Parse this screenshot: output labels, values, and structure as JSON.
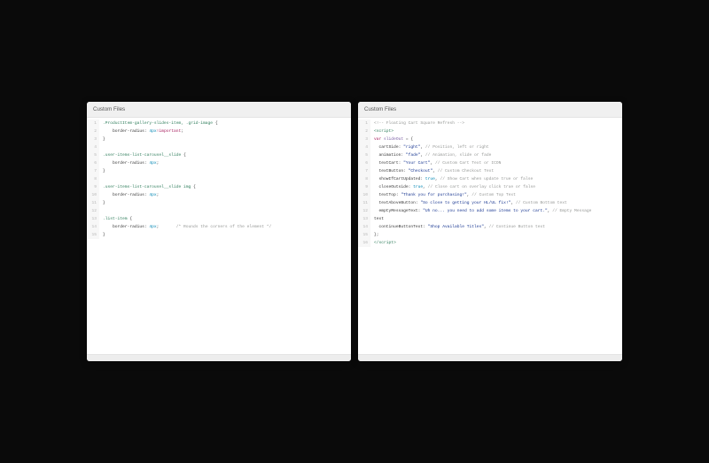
{
  "left": {
    "title": "Custom Files",
    "lines": [
      {
        "n": 1,
        "tokens": [
          {
            "c": "t-sel",
            "t": ".ProductItem-gallery-slides-item, .grid-image "
          },
          {
            "c": "t-punc",
            "t": "{"
          }
        ]
      },
      {
        "n": 2,
        "tokens": [
          {
            "c": "",
            "t": "    "
          },
          {
            "c": "t-prop",
            "t": "border-radius"
          },
          {
            "c": "t-punc",
            "t": ": "
          },
          {
            "c": "t-num",
            "t": "4px"
          },
          {
            "c": "t-key",
            "t": "!important"
          },
          {
            "c": "t-punc",
            "t": ";"
          }
        ]
      },
      {
        "n": 3,
        "tokens": [
          {
            "c": "t-punc",
            "t": "}"
          }
        ]
      },
      {
        "n": 4,
        "tokens": [
          {
            "c": "",
            "t": " "
          }
        ]
      },
      {
        "n": 5,
        "tokens": [
          {
            "c": "t-sel",
            "t": ".user-items-list-carousel__slide "
          },
          {
            "c": "t-punc",
            "t": "{"
          }
        ]
      },
      {
        "n": 6,
        "tokens": [
          {
            "c": "",
            "t": "    "
          },
          {
            "c": "t-prop",
            "t": "border-radius"
          },
          {
            "c": "t-punc",
            "t": ": "
          },
          {
            "c": "t-num",
            "t": "4px"
          },
          {
            "c": "t-punc",
            "t": ";"
          }
        ]
      },
      {
        "n": 7,
        "tokens": [
          {
            "c": "t-punc",
            "t": "}"
          }
        ]
      },
      {
        "n": 8,
        "tokens": [
          {
            "c": "",
            "t": " "
          }
        ]
      },
      {
        "n": 9,
        "tokens": [
          {
            "c": "t-sel",
            "t": ".user-items-list-carousel__slide img "
          },
          {
            "c": "t-punc",
            "t": "{"
          }
        ]
      },
      {
        "n": 10,
        "tokens": [
          {
            "c": "",
            "t": "    "
          },
          {
            "c": "t-prop",
            "t": "border-radius"
          },
          {
            "c": "t-punc",
            "t": ": "
          },
          {
            "c": "t-num",
            "t": "4px"
          },
          {
            "c": "t-punc",
            "t": ";"
          }
        ]
      },
      {
        "n": 11,
        "tokens": [
          {
            "c": "t-punc",
            "t": "}"
          }
        ]
      },
      {
        "n": 12,
        "tokens": [
          {
            "c": "",
            "t": " "
          }
        ]
      },
      {
        "n": 13,
        "tokens": [
          {
            "c": "t-sel",
            "t": ".list-item "
          },
          {
            "c": "t-punc",
            "t": "{"
          }
        ]
      },
      {
        "n": 14,
        "tokens": [
          {
            "c": "",
            "t": "    "
          },
          {
            "c": "t-prop",
            "t": "border-radius"
          },
          {
            "c": "t-punc",
            "t": ": "
          },
          {
            "c": "t-num",
            "t": "4px"
          },
          {
            "c": "t-punc",
            "t": ";       "
          },
          {
            "c": "t-com",
            "t": "/* Rounds the corners of the element */"
          }
        ]
      },
      {
        "n": 15,
        "tokens": [
          {
            "c": "t-punc",
            "t": "}"
          }
        ]
      }
    ]
  },
  "right": {
    "title": "Custom Files",
    "lines": [
      {
        "n": 1,
        "tokens": [
          {
            "c": "t-com",
            "t": "<!-- Floating Cart Square Refresh -->"
          }
        ]
      },
      {
        "n": 2,
        "tokens": [
          {
            "c": "t-sel",
            "t": "<script>"
          }
        ]
      },
      {
        "n": 3,
        "tokens": [
          {
            "c": "t-key",
            "t": "var "
          },
          {
            "c": "t-name",
            "t": "slideOut"
          },
          {
            "c": "t-punc",
            "t": " = {"
          }
        ]
      },
      {
        "n": 4,
        "tokens": [
          {
            "c": "",
            "t": "  "
          },
          {
            "c": "t-attr",
            "t": "cartSide"
          },
          {
            "c": "t-punc",
            "t": ": "
          },
          {
            "c": "t-str",
            "t": "\"right\""
          },
          {
            "c": "t-punc",
            "t": ", "
          },
          {
            "c": "t-com",
            "t": "// Position, left or right"
          }
        ]
      },
      {
        "n": 5,
        "tokens": [
          {
            "c": "",
            "t": "  "
          },
          {
            "c": "t-attr",
            "t": "animation"
          },
          {
            "c": "t-punc",
            "t": ": "
          },
          {
            "c": "t-str",
            "t": "\"fade\""
          },
          {
            "c": "t-punc",
            "t": ", "
          },
          {
            "c": "t-com",
            "t": "// Animation, slide or fade"
          }
        ]
      },
      {
        "n": 6,
        "tokens": [
          {
            "c": "",
            "t": "  "
          },
          {
            "c": "t-attr",
            "t": "textCart"
          },
          {
            "c": "t-punc",
            "t": ": "
          },
          {
            "c": "t-str",
            "t": "\"Your Cart\""
          },
          {
            "c": "t-punc",
            "t": ", "
          },
          {
            "c": "t-com",
            "t": "// Custom Cart Text or ICON"
          }
        ]
      },
      {
        "n": 7,
        "tokens": [
          {
            "c": "",
            "t": "  "
          },
          {
            "c": "t-attr",
            "t": "textButton"
          },
          {
            "c": "t-punc",
            "t": ": "
          },
          {
            "c": "t-str",
            "t": "\"Checkout\""
          },
          {
            "c": "t-punc",
            "t": ", "
          },
          {
            "c": "t-com",
            "t": "// Custom Checkout Text"
          }
        ]
      },
      {
        "n": 8,
        "tokens": [
          {
            "c": "",
            "t": "  "
          },
          {
            "c": "t-attr",
            "t": "showIfCartUpdated"
          },
          {
            "c": "t-punc",
            "t": ": "
          },
          {
            "c": "t-bool",
            "t": "true"
          },
          {
            "c": "t-punc",
            "t": ", "
          },
          {
            "c": "t-com",
            "t": "// Show Cart when update true or false"
          }
        ]
      },
      {
        "n": 9,
        "tokens": [
          {
            "c": "",
            "t": "  "
          },
          {
            "c": "t-attr",
            "t": "closeOutside"
          },
          {
            "c": "t-punc",
            "t": ": "
          },
          {
            "c": "t-bool",
            "t": "true"
          },
          {
            "c": "t-punc",
            "t": ", "
          },
          {
            "c": "t-com",
            "t": "// Close cart on overlay click true or false"
          }
        ]
      },
      {
        "n": 10,
        "tokens": [
          {
            "c": "",
            "t": "  "
          },
          {
            "c": "t-attr",
            "t": "textTop"
          },
          {
            "c": "t-punc",
            "t": ": "
          },
          {
            "c": "t-str",
            "t": "\"Thank you for purchasing!\""
          },
          {
            "c": "t-punc",
            "t": ", "
          },
          {
            "c": "t-com",
            "t": "// Custom Top Text"
          }
        ]
      },
      {
        "n": 11,
        "tokens": [
          {
            "c": "",
            "t": "  "
          },
          {
            "c": "t-attr",
            "t": "textAboveButton"
          },
          {
            "c": "t-punc",
            "t": ": "
          },
          {
            "c": "t-str",
            "t": "\"So close to getting your HL/UL fix!\""
          },
          {
            "c": "t-punc",
            "t": ", "
          },
          {
            "c": "t-com",
            "t": "// Custom Bottom text"
          }
        ]
      },
      {
        "n": 12,
        "tokens": [
          {
            "c": "",
            "t": "  "
          },
          {
            "c": "t-attr",
            "t": "emptyMessageText"
          },
          {
            "c": "t-punc",
            "t": ": "
          },
          {
            "c": "t-str",
            "t": "\"Uh no... you need to add some items to your cart.\""
          },
          {
            "c": "t-punc",
            "t": ", "
          },
          {
            "c": "t-com",
            "t": "// Empty Message"
          }
        ]
      },
      {
        "n": 13,
        "tokens": [
          {
            "c": "t-attr",
            "t": "text"
          }
        ]
      },
      {
        "n": 14,
        "tokens": [
          {
            "c": "",
            "t": "  "
          },
          {
            "c": "t-attr",
            "t": "continueButtonText"
          },
          {
            "c": "t-punc",
            "t": ": "
          },
          {
            "c": "t-str",
            "t": "\"Shop Available Titles\""
          },
          {
            "c": "t-punc",
            "t": ", "
          },
          {
            "c": "t-com",
            "t": "// Continue Button text"
          }
        ]
      },
      {
        "n": 15,
        "tokens": [
          {
            "c": "t-punc",
            "t": "};"
          }
        ]
      },
      {
        "n": 16,
        "tokens": [
          {
            "c": "t-sel",
            "t": "</scr"
          },
          {
            "c": "t-sel",
            "t": "ipt>"
          }
        ]
      }
    ]
  }
}
